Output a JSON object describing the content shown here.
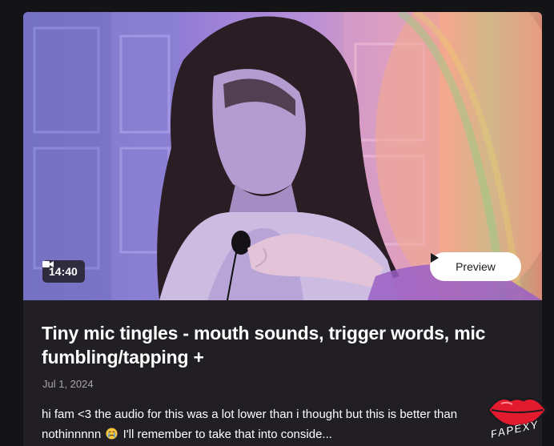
{
  "post": {
    "duration": "14:40",
    "preview_label": "Preview",
    "title": "Tiny mic tingles - mouth sounds, trigger words, mic fumbling/tapping +",
    "date": "Jul 1, 2024",
    "description_line1": "hi fam <3 the audio for this was a lot lower than i thought but this is better than",
    "description_line2_start": "nothinnnnn",
    "description_line2_end": "I'll remember to take that into conside..."
  },
  "watermark": {
    "text": "FAPEXY"
  },
  "icons": {
    "duration": "video-camera-icon",
    "preview": "play-icon",
    "description_emoji": "crying-face-emoji"
  },
  "colors": {
    "page_background": "#141316",
    "card_background": "#221f24",
    "title_text": "#ffffff",
    "date_text": "#a8a5ad",
    "preview_button": "#ffffff",
    "watermark_lips": "#e21b2e"
  }
}
